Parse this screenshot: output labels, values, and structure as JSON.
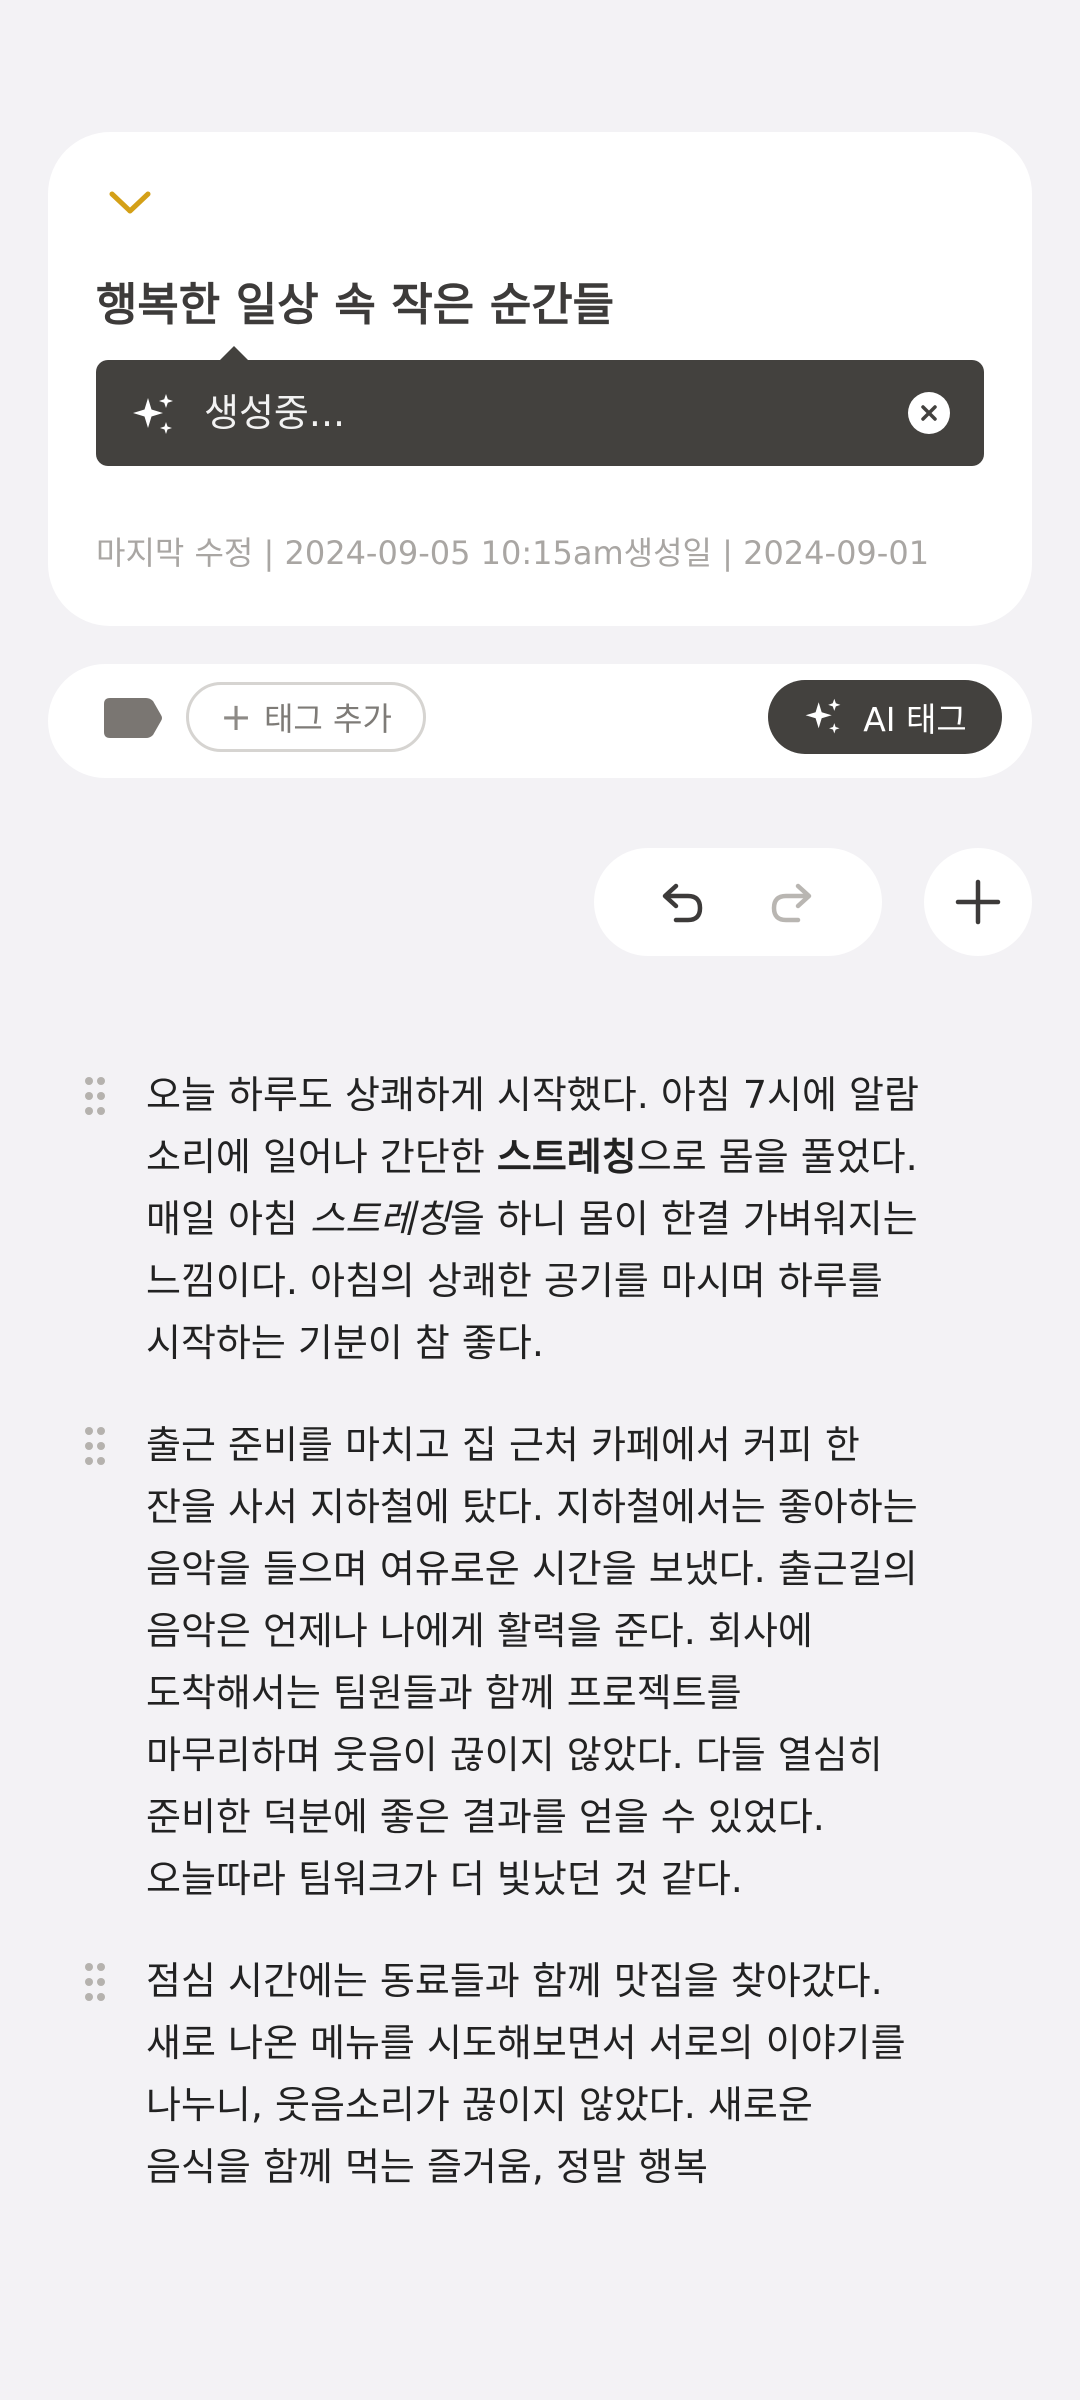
{
  "header": {
    "title": "행복한 일상 속 작은 순간들",
    "generating_text": "생성중...",
    "meta": "마지막 수정 | 2024-09-05 10:15am생성일 | 2024-09-01"
  },
  "tags": {
    "add_label": "태그 추가",
    "ai_tag_label": "AI 태그"
  },
  "paragraphs": [
    {
      "part1": "오늘 하루도 상쾌하게 시작했다. 아침 7시에 알람 소리에 일어나 간단한 ",
      "bold": "스트레칭",
      "part2": "으로 몸을 풀었다. 매일 아침 ",
      "italic": "스트레칭",
      "part3": "을 하니 몸이 한결 가벼워지는 느낌이다. 아침의 상쾌한 공기를 마시며 하루를 시작하는 기분이 참 좋다."
    },
    {
      "text": "출근 준비를 마치고 집 근처 카페에서 커피 한 잔을 사서 지하철에 탔다. 지하철에서는 좋아하는 음악을 들으며 여유로운 시간을 보냈다. 출근길의 음악은 언제나 나에게 활력을 준다. 회사에 도착해서는 팀원들과 함께 프로젝트를 마무리하며 웃음이 끊이지 않았다. 다들 열심히 준비한 덕분에 좋은 결과를 얻을 수 있었다. 오늘따라 팀워크가 더 빛났던 것 같다."
    },
    {
      "text": "점심 시간에는 동료들과 함께 맛집을 찾아갔다. 새로 나온 메뉴를 시도해보면서 서로의 이야기를 나누니, 웃음소리가 끊이지 않았다. 새로운 음식을 함께 먹는 즐거움, 정말 행복"
    }
  ],
  "colors": {
    "background": "#f3f2f5",
    "card": "#ffffff",
    "dark": "#43413e",
    "accent": "#d4a017"
  },
  "icons": {
    "collapse": "chevron-down-icon",
    "sparkle": "sparkle-icon",
    "close": "close-circle-icon",
    "tag": "tag-icon",
    "undo": "undo-icon",
    "redo": "redo-icon",
    "add": "plus-icon",
    "drag": "drag-handle-icon"
  }
}
